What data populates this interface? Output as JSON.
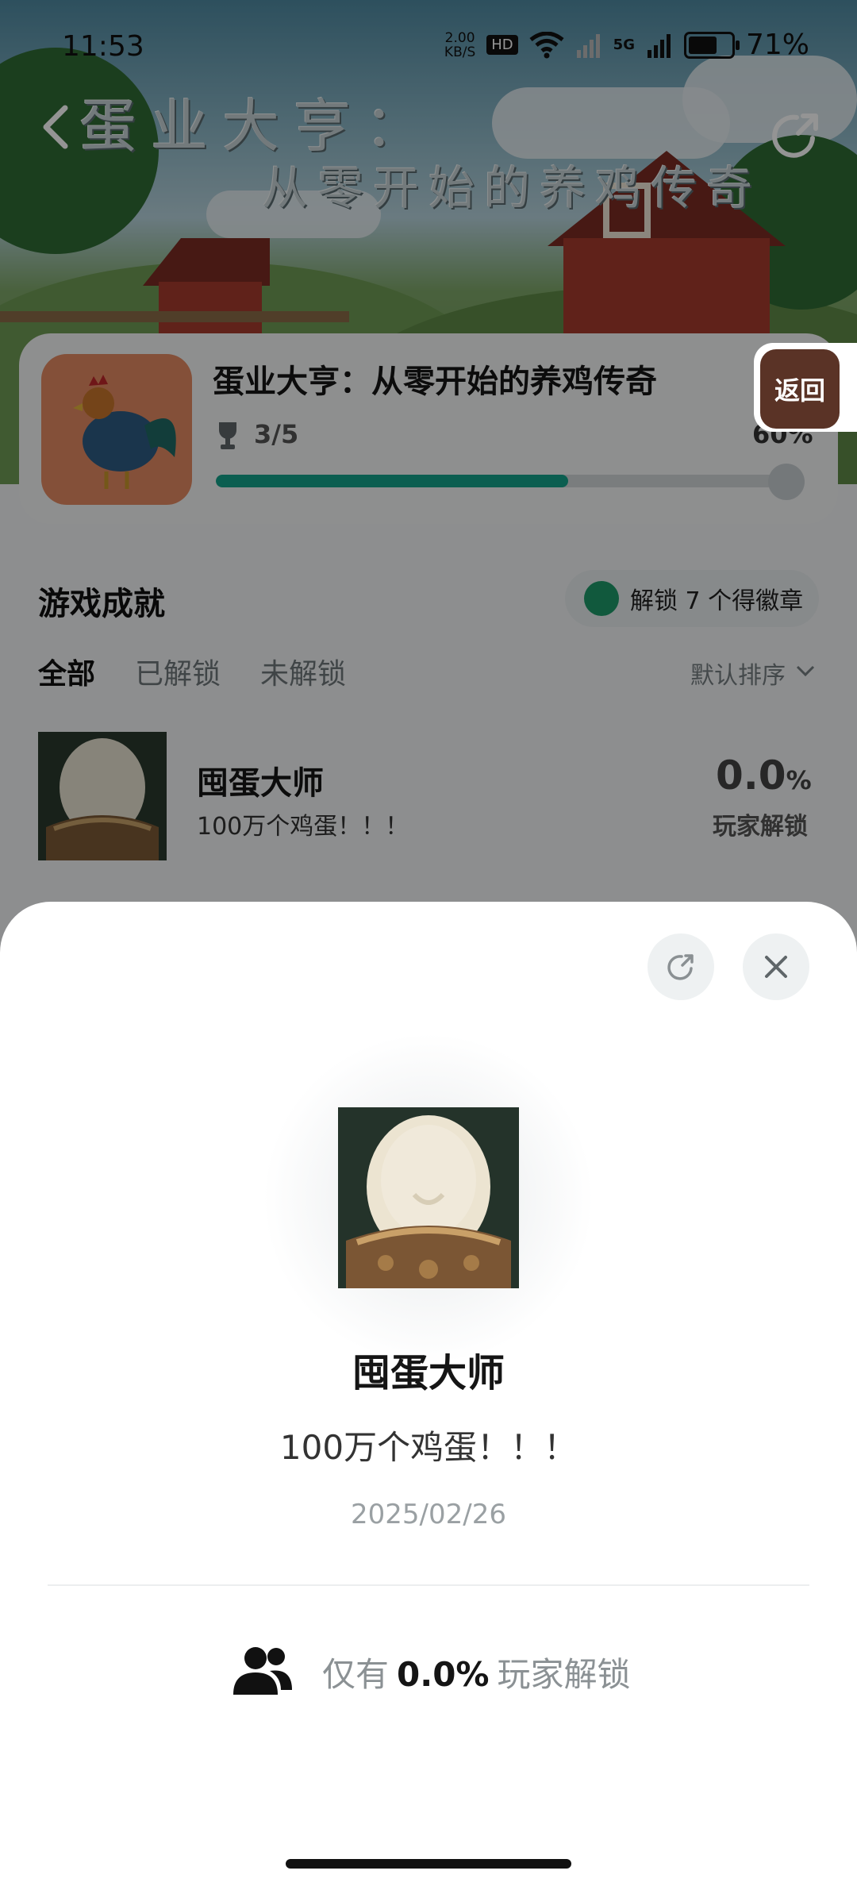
{
  "status_bar": {
    "time": "11:53",
    "net_speed_value": "2.00",
    "net_speed_unit": "KB/S",
    "hd_badge": "HD",
    "sig_label": "5G",
    "battery_pct": "71%",
    "battery_level": 0.71
  },
  "hero": {
    "title_line1": "蛋业大亨：",
    "title_line2": "从零开始的养鸡传奇"
  },
  "game_card": {
    "title": "蛋业大亨：从零开始的养鸡传奇",
    "achievements_progress": "3/5",
    "progress_pct": "60%",
    "progress_value": 0.6
  },
  "floating_back": {
    "label": "返回"
  },
  "achievements_section": {
    "title": "游戏成就",
    "badge_pill": "解锁 7 个得徽章",
    "tabs": [
      "全部",
      "已解锁",
      "未解锁"
    ],
    "active_tab": "全部",
    "sort_label": "默认排序"
  },
  "achievement_row": {
    "title": "囤蛋大师",
    "description": "100万个鸡蛋！！！",
    "pct_value": "0.0",
    "pct_unit": "%",
    "pct_sub": "玩家解锁"
  },
  "sheet": {
    "title": "囤蛋大师",
    "description": "100万个鸡蛋！！！",
    "date": "2025/02/26",
    "stat_prefix": "仅有",
    "stat_value": "0.0%",
    "stat_suffix": "玩家解锁"
  },
  "colors": {
    "accent": "#14a38a",
    "scrim": "rgba(0,0,0,0.42)"
  },
  "icons": [
    "back-icon",
    "share-icon",
    "trophy-icon",
    "chevron-down-icon",
    "close-icon",
    "users-icon"
  ]
}
